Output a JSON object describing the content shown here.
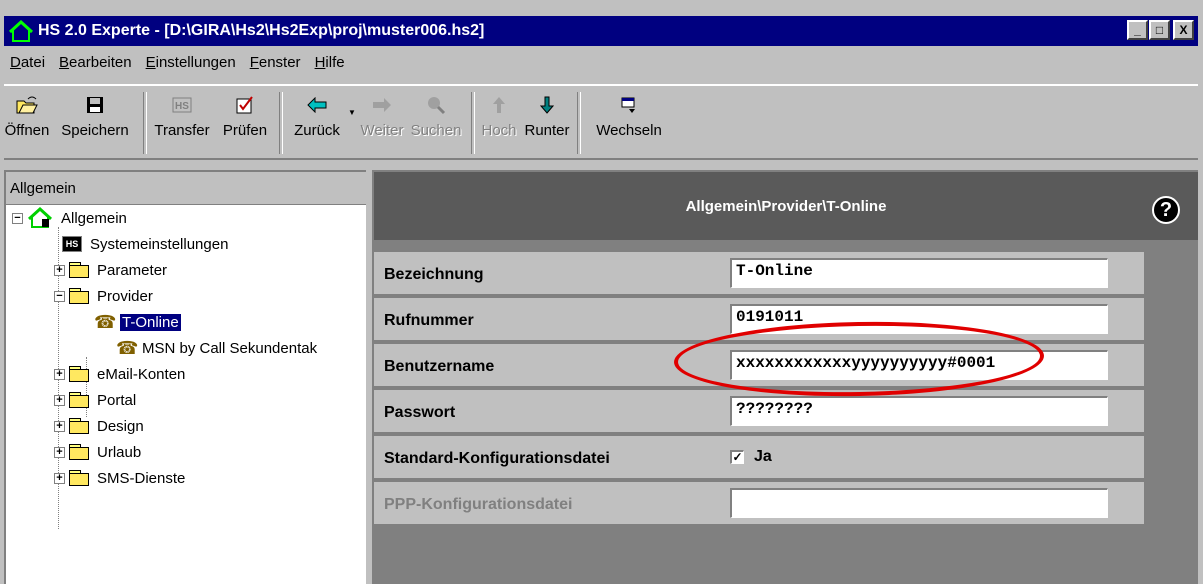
{
  "window": {
    "title": "HS 2.0 Experte - [D:\\GIRA\\Hs2\\Hs2Exp\\proj\\muster006.hs2]",
    "controls": [
      "_",
      "□",
      "X"
    ]
  },
  "menu": [
    {
      "pre": "",
      "u": "D",
      "post": "atei"
    },
    {
      "pre": "",
      "u": "B",
      "post": "earbeiten"
    },
    {
      "pre": "",
      "u": "E",
      "post": "instellungen"
    },
    {
      "pre": "",
      "u": "F",
      "post": "enster"
    },
    {
      "pre": "",
      "u": "H",
      "post": "ilfe"
    }
  ],
  "toolbar": {
    "open": "Öffnen",
    "save": "Speichern",
    "transfer": "Transfer",
    "check": "Prüfen",
    "back": "Zurück",
    "forward": "Weiter",
    "search": "Suchen",
    "up": "Hoch",
    "down": "Runter",
    "switch": "Wechseln"
  },
  "tree": {
    "header": "Allgemein",
    "root": "Allgemein",
    "items": {
      "system": "Systemeinstellungen",
      "parameter": "Parameter",
      "provider": "Provider",
      "tonline": "T-Online",
      "msn": "MSN by Call Sekundentak",
      "email": "eMail-Konten",
      "portal": "Portal",
      "design": "Design",
      "urlaub": "Urlaub",
      "sms": "SMS-Dienste"
    }
  },
  "panel": {
    "path": "Allgemein\\Provider\\T-Online",
    "help": "?",
    "fields": {
      "bezeichnung": {
        "label": "Bezeichnung",
        "value": "T-Online"
      },
      "rufnummer": {
        "label": "Rufnummer",
        "value": "0191011"
      },
      "benutzername": {
        "label": "Benutzername",
        "value": "xxxxxxxxxxxxyyyyyyyyyy#0001"
      },
      "passwort": {
        "label": "Passwort",
        "value": "????????"
      },
      "standard": {
        "label": "Standard-Konfigurationsdatei",
        "check_label": "Ja",
        "checked": true
      },
      "ppp": {
        "label": "PPP-Konfigurationsdatei",
        "value": ""
      }
    }
  },
  "colors": {
    "title_bar": "#000080",
    "panel_header": "#5a5a5a",
    "highlight": "#e00000"
  }
}
